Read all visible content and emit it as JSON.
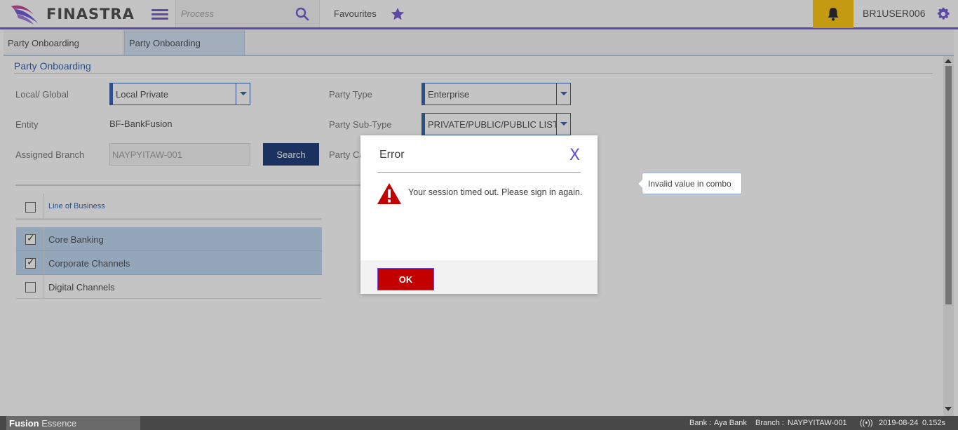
{
  "header": {
    "brand": "FINASTRA",
    "process_placeholder": "Process",
    "favourites": "Favourites",
    "username": "BR1USER006"
  },
  "tabs": [
    {
      "label": "Party Onboarding"
    },
    {
      "label": "Party Onboarding"
    }
  ],
  "form": {
    "section_title": "Party Onboarding",
    "local_global_label": "Local/ Global",
    "local_global_value": "Local Private",
    "entity_label": "Entity",
    "entity_value": "BF-BankFusion",
    "branch_label": "Assigned Branch",
    "branch_value": "NAYPYITAW-001",
    "search_button": "Search",
    "party_type_label": "Party Type",
    "party_type_value": "Enterprise",
    "party_subtype_label": "Party Sub-Type",
    "party_subtype_value": "PRIVATE/PUBLIC/PUBLIC LISTED C",
    "party_category_label": "Party Ca"
  },
  "grid": {
    "header": "Line of Business",
    "rows": [
      {
        "label": "Core Banking",
        "checked": true
      },
      {
        "label": "Corporate Channels",
        "checked": true
      },
      {
        "label": "Digital Channels",
        "checked": false
      }
    ]
  },
  "tooltip": "Invalid value in combo",
  "dialog": {
    "title": "Error",
    "close": "X",
    "message": "Your session timed out. Please sign in again.",
    "ok": "OK"
  },
  "status": {
    "brand_bold": "Fusion",
    "brand_light": " Essence",
    "bank_label": "Bank :",
    "bank_value": "Aya Bank",
    "branch_label": "Branch :",
    "branch_value": "NAYPYITAW-001",
    "signal": "((•))",
    "date": "2019-08-24",
    "timing": "0.152s"
  },
  "colors": {
    "accent": "#694ed6",
    "navy": "#0d2f70",
    "link_blue": "#2558a6",
    "bell_bg": "#ffc300",
    "ok_red": "#c20000"
  },
  "icons": [
    "finastra-logo",
    "hamburger-menu-icon",
    "search-icon",
    "star-icon",
    "bell-icon",
    "gear-icon",
    "warning-icon",
    "close-icon"
  ]
}
